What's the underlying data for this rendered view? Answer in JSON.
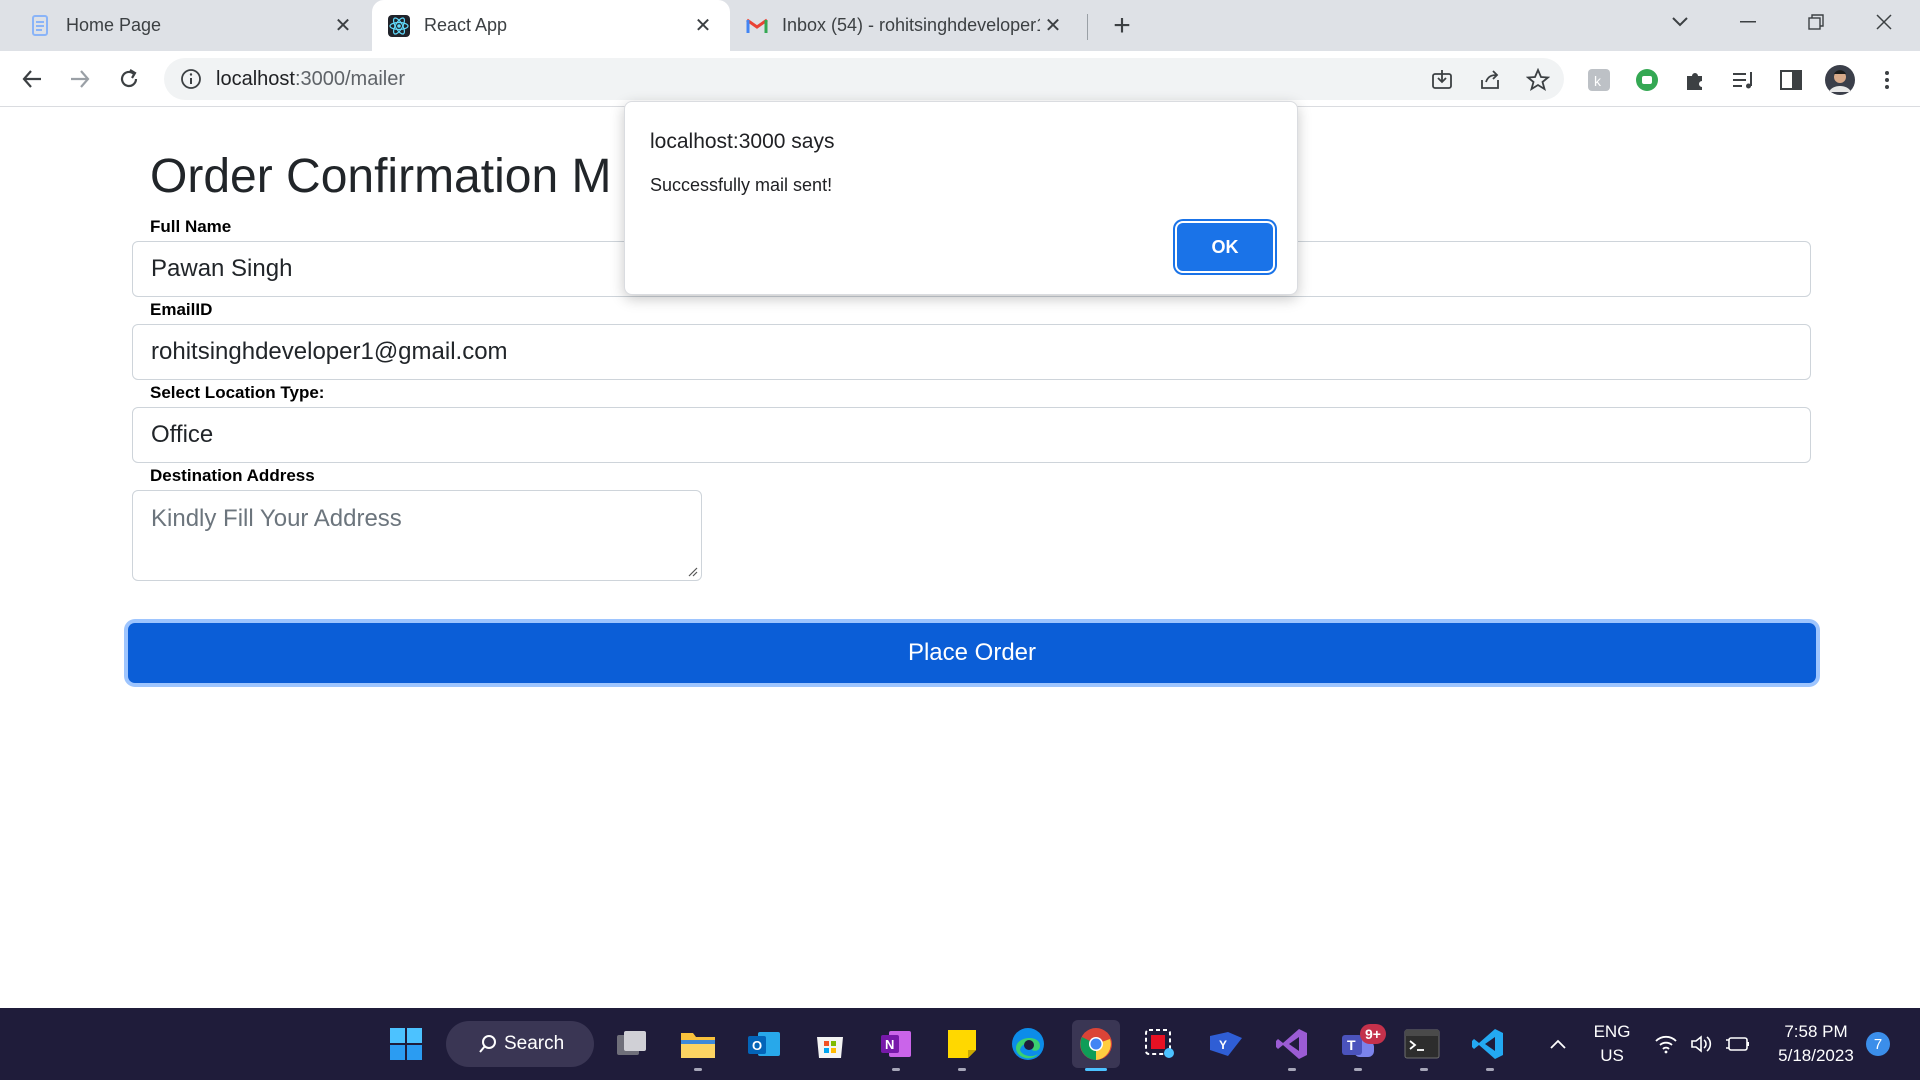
{
  "browser": {
    "tabs": [
      {
        "title": "Home Page",
        "active": false,
        "favicon": "document-icon"
      },
      {
        "title": "React App",
        "active": true,
        "favicon": "react-icon"
      },
      {
        "title": "Inbox (54) - rohitsinghdeveloper1",
        "active": false,
        "favicon": "gmail-icon"
      }
    ],
    "url_host": "localhost",
    "url_path": ":3000/mailer"
  },
  "page": {
    "title": "Order Confirmation M",
    "fields": {
      "full_name_label": "Full Name",
      "full_name_value": "Pawan Singh",
      "email_label": "EmailID",
      "email_value": "rohitsinghdeveloper1@gmail.com",
      "location_label": "Select Location Type:",
      "location_value": "Office",
      "address_label": "Destination Address",
      "address_placeholder": "Kindly Fill Your Address"
    },
    "submit_label": "Place Order"
  },
  "dialog": {
    "title": "localhost:3000 says",
    "message": "Successfully mail sent!",
    "ok_label": "OK"
  },
  "taskbar": {
    "search_label": "Search",
    "teams_badge": "9+",
    "language_top": "ENG",
    "language_bottom": "US",
    "time": "7:58 PM",
    "date": "5/18/2023",
    "notification_count": "7"
  },
  "colors": {
    "primary_button": "#0b5ed7",
    "dialog_ok": "#1a73e8",
    "taskbar": "#1f1c3a"
  }
}
